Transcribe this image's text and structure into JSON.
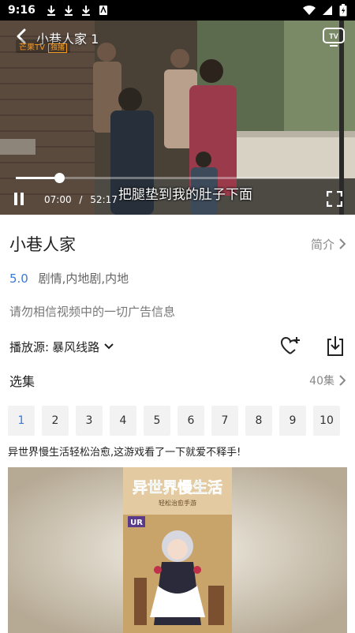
{
  "status_bar": {
    "time": "9:16",
    "icons": [
      "download-icon",
      "download-icon",
      "download-icon",
      "app-icon",
      "wifi-icon",
      "signal-icon",
      "battery-icon"
    ]
  },
  "player": {
    "title": "小巷人家 1",
    "logo_text": "芒果TV",
    "logo_tag": "独播",
    "subtitle": "把腿垫到我的肚子下面",
    "current_time": "07:00",
    "separator": "/",
    "duration": "52:17",
    "progress": 0.134
  },
  "details": {
    "title": "小巷人家",
    "intro_label": "简介",
    "rating": "5.0",
    "genres": "剧情,内地剧,内地",
    "notice": "请勿相信视频中的一切广告信息",
    "source_label": "播放源:",
    "source_value": "暴风线路"
  },
  "episodes": {
    "title": "选集",
    "count": "40集",
    "items": [
      "1",
      "2",
      "3",
      "4",
      "5",
      "6",
      "7",
      "8",
      "9",
      "10"
    ],
    "active_index": 0
  },
  "ad": {
    "text": "异世界慢生活轻松治愈,这游戏看了一下就爱不释手!",
    "poster_title": "异世界慢生活",
    "poster_subtitle": "轻松治愈手游",
    "poster_badge": "UR"
  },
  "colors": {
    "accent": "#3a78d8",
    "logo": "#f39b23"
  }
}
